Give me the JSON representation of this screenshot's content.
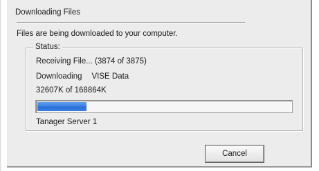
{
  "dialog": {
    "title": "Downloading Files",
    "message": "Files are being downloaded to your computer."
  },
  "status": {
    "legend": "Status:",
    "receiving": "Receiving File... (3874 of 3875)",
    "downloading_label": "Downloading",
    "downloading_item": "VISE Data",
    "size_progress": "32607K of 168864K",
    "progress_fraction": 0.193,
    "progress_color": "#3d83e4",
    "server": "Tanager Server 1"
  },
  "buttons": {
    "cancel": "Cancel"
  }
}
